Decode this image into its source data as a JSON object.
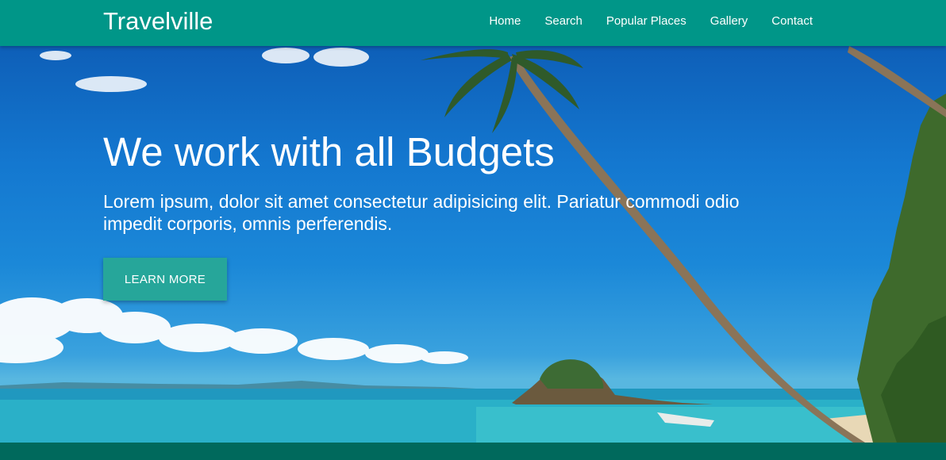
{
  "navbar": {
    "brand": "Travelville",
    "links": [
      "Home",
      "Search",
      "Popular Places",
      "Gallery",
      "Contact"
    ]
  },
  "hero": {
    "title": "We work with all Budgets",
    "text": "Lorem ipsum, dolor sit amet consectetur adipisicing elit. Pariatur commodi odio impedit corporis, omnis perferendis.",
    "button_label": "LEARN MORE"
  },
  "colors": {
    "navbar": "#009688",
    "button": "#26a69a",
    "footer": "#00695c"
  }
}
